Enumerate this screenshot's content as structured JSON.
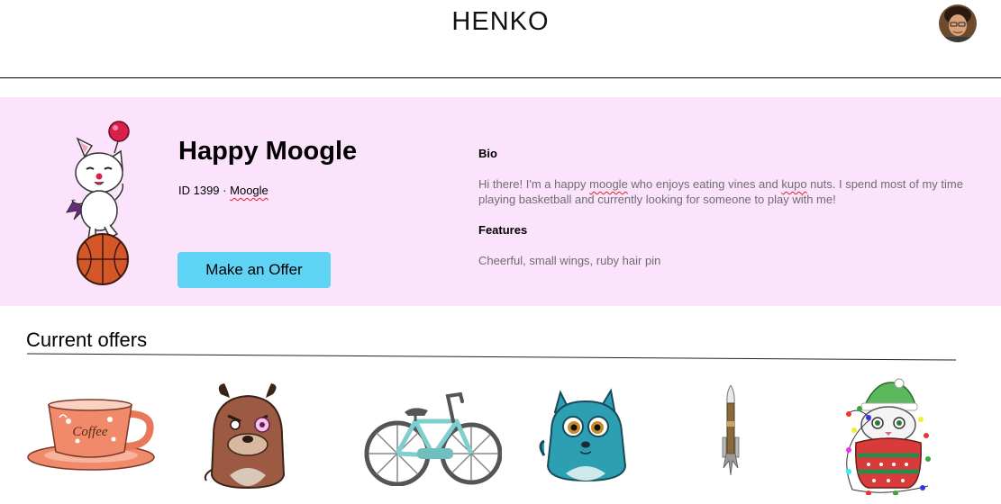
{
  "header": {
    "brand": "HENKO",
    "avatar_icon": "user-avatar"
  },
  "profile": {
    "name": "Happy Moogle",
    "id_label": "ID 1399",
    "separator": "·",
    "species": "Moogle",
    "offer_button": "Make an Offer",
    "bio_title": "Bio",
    "bio_parts": [
      "Hi there! I'm a happy ",
      "moogle",
      " who enjoys eating vines and ",
      "kupo",
      " nuts. I spend most of my time playing basketball and currently looking for someone to play with me!"
    ],
    "features_title": "Features",
    "features_text": "Cheerful, small wings, ruby hair pin"
  },
  "offers": {
    "title": "Current offers",
    "items": [
      {
        "icon": "coffee-cup-icon",
        "cup_text": "Coffee"
      },
      {
        "icon": "brown-dog-icon"
      },
      {
        "icon": "bicycle-icon"
      },
      {
        "icon": "blue-cat-icon"
      },
      {
        "icon": "rocket-icon"
      },
      {
        "icon": "christmas-cat-icon"
      }
    ]
  },
  "colors": {
    "hero_bg": "#fbe3fb",
    "button": "#5fd3f3",
    "muted_text": "#6e6e6e"
  }
}
